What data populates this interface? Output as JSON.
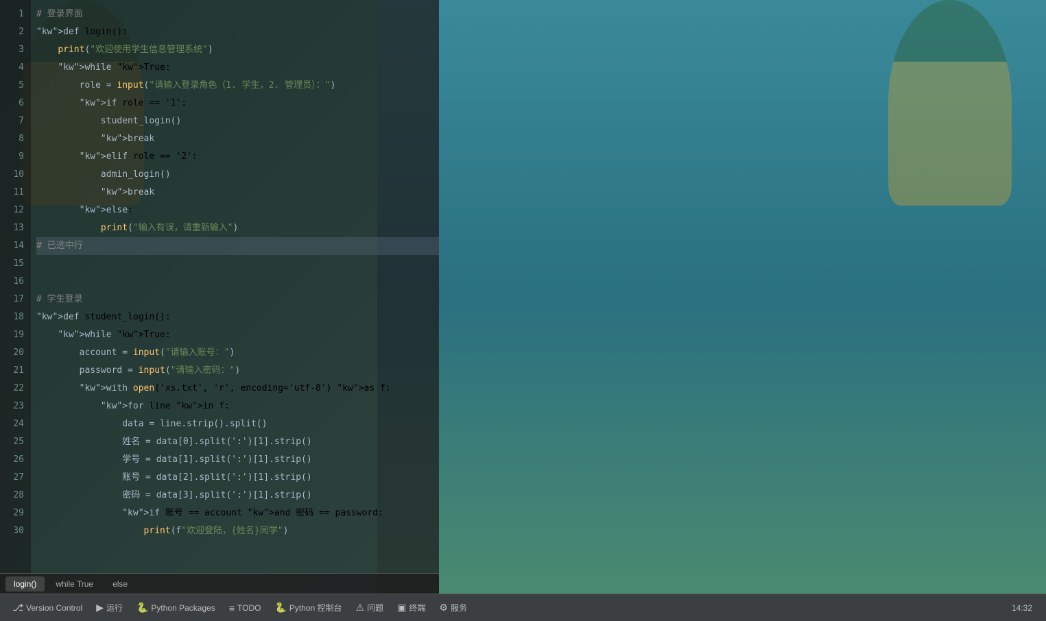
{
  "editor": {
    "background": "#1e1e1e",
    "lines": [
      {
        "num": 1,
        "code": "# 登录界面",
        "type": "comment"
      },
      {
        "num": 2,
        "code": "def login():",
        "type": "code"
      },
      {
        "num": 3,
        "code": "    print(\"欢迎使用学生信息管理系统\")",
        "type": "code"
      },
      {
        "num": 4,
        "code": "    while True:",
        "type": "code"
      },
      {
        "num": 5,
        "code": "        role = input(\"请输入登录角色（1. 学生，2. 管理员）：\")",
        "type": "code"
      },
      {
        "num": 6,
        "code": "        if role == '1':",
        "type": "code"
      },
      {
        "num": 7,
        "code": "            student_login()",
        "type": "code"
      },
      {
        "num": 8,
        "code": "            break",
        "type": "code"
      },
      {
        "num": 9,
        "code": "        elif role == '2':",
        "type": "code"
      },
      {
        "num": 10,
        "code": "            admin_login()",
        "type": "code"
      },
      {
        "num": 11,
        "code": "            break",
        "type": "code"
      },
      {
        "num": 12,
        "code": "        else:",
        "type": "code"
      },
      {
        "num": 13,
        "code": "            print(\"输入有误，请重新输入\")",
        "type": "code"
      },
      {
        "num": 14,
        "code": "# 已选中行",
        "type": "selected"
      },
      {
        "num": 15,
        "code": "",
        "type": "empty"
      },
      {
        "num": 16,
        "code": "",
        "type": "empty"
      },
      {
        "num": 17,
        "code": "# 学生登录",
        "type": "comment"
      },
      {
        "num": 18,
        "code": "def student_login():",
        "type": "code"
      },
      {
        "num": 19,
        "code": "    while True:",
        "type": "code"
      },
      {
        "num": 20,
        "code": "        account = input(\"请输入账号：\")",
        "type": "code"
      },
      {
        "num": 21,
        "code": "        password = input(\"请输入密码：\")",
        "type": "code"
      },
      {
        "num": 22,
        "code": "        with open('xs.txt', 'r', encoding='utf-8') as f:",
        "type": "code"
      },
      {
        "num": 23,
        "code": "            for line in f:",
        "type": "code"
      },
      {
        "num": 24,
        "code": "                data = line.strip().split()",
        "type": "code"
      },
      {
        "num": 25,
        "code": "                姓名 = data[0].split(':')[1].strip()",
        "type": "code"
      },
      {
        "num": 26,
        "code": "                学号 = data[1].split(':')[1].strip()",
        "type": "code"
      },
      {
        "num": 27,
        "code": "                账号 = data[2].split(':')[1].strip()",
        "type": "code"
      },
      {
        "num": 28,
        "code": "                密码 = data[3].split(':')[1].strip()",
        "type": "code"
      },
      {
        "num": 29,
        "code": "                if 账号 == account and 密码 == password:",
        "type": "code"
      },
      {
        "num": 30,
        "code": "                    print(f\"欢迎登陆，{姓名}同学\")",
        "type": "code"
      }
    ]
  },
  "bottom_tabs": [
    {
      "label": "login()",
      "active": true
    },
    {
      "label": "while True",
      "active": false
    },
    {
      "label": "else",
      "active": false
    }
  ],
  "status_bar": {
    "items": [
      {
        "icon": "⎇",
        "label": "Version Control"
      },
      {
        "icon": "▶",
        "label": "运行"
      },
      {
        "icon": "🐍",
        "label": "Python Packages"
      },
      {
        "icon": "≡",
        "label": "TODO"
      },
      {
        "icon": "🐍",
        "label": "Python 控制台"
      },
      {
        "icon": "⚠",
        "label": "问题"
      },
      {
        "icon": "▣",
        "label": "终端"
      },
      {
        "icon": "⚙",
        "label": "服务"
      }
    ],
    "time": "14:32"
  }
}
